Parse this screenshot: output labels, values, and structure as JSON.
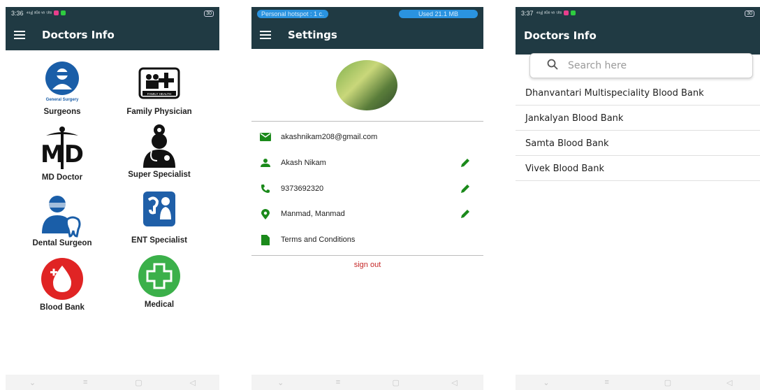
{
  "screen1": {
    "status_time": "3:36",
    "status_signal": "⁴⁶ıl ˢᴳᵒ ᵛᵒ ⁵ˡᵗᵉ",
    "status_battery": "30",
    "title": "Doctors Info",
    "items": [
      {
        "label": "Surgeons",
        "icon": "general-surgery-icon",
        "icon_text": "General Surgery"
      },
      {
        "label": "Family Physician",
        "icon": "family-health-icon",
        "icon_text": "FAMILY HEALTH"
      },
      {
        "label": "MD Doctor",
        "icon": "md-caduceus-icon"
      },
      {
        "label": "Super Specialist",
        "icon": "doctor-stethoscope-icon"
      },
      {
        "label": "Dental Surgeon",
        "icon": "dental-surgeon-icon"
      },
      {
        "label": "ENT Specialist",
        "icon": "ent-icon"
      },
      {
        "label": "Blood Bank",
        "icon": "blood-drop-icon"
      },
      {
        "label": "Medical",
        "icon": "medical-cross-icon"
      }
    ]
  },
  "screen2": {
    "hotspot_text": "Personal hotspot : 1 c.",
    "used_text": "Used 21.1 MB",
    "title": "Settings",
    "email": "akashnikam208@gmail.com",
    "name": "Akash Nikam",
    "phone": "9373692320",
    "location": "Manmad, Manmad",
    "terms": "Terms and Conditions",
    "signout": "sign out"
  },
  "screen3": {
    "status_time": "3:37",
    "status_signal": "⁴⁶ıl ˢᴳᵒ ᵛᵒ ⁵ˡᵗᵉ",
    "status_battery": "30",
    "title": "Doctors Info",
    "search_placeholder": "Search here",
    "items": [
      "Dhanvantari Multispeciality Blood Bank",
      "Jankalyan Blood Bank",
      "Samta Blood Bank",
      "Vivek Blood Bank"
    ]
  },
  "colors": {
    "appbar": "#203a43",
    "accent_green": "#1b8a1b",
    "signout_red": "#c62828"
  }
}
